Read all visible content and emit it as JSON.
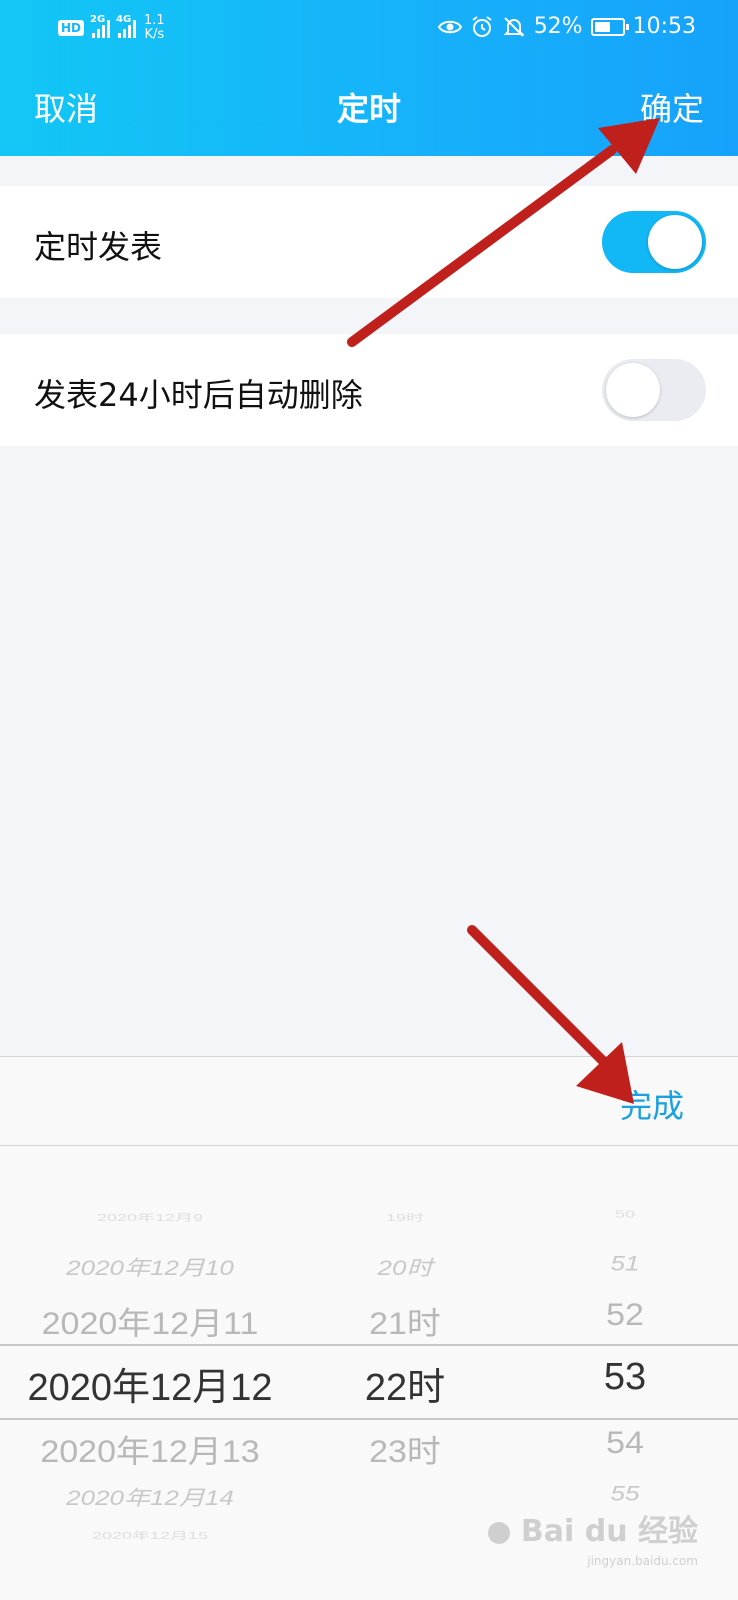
{
  "status_bar": {
    "hd": "HD",
    "sim1": "2G",
    "sim2": "4G",
    "speed": "1.1",
    "speed_unit": "K/s",
    "battery": "52%",
    "time": "10:53"
  },
  "nav": {
    "cancel": "取消",
    "title": "定时",
    "confirm": "确定"
  },
  "settings": {
    "schedule_label": "定时发表",
    "schedule_on": true,
    "auto_delete_label": "发表24小时后自动删除",
    "auto_delete_on": false
  },
  "picker": {
    "done": "完成",
    "dates": [
      "2020年12月9",
      "2020年12月10",
      "2020年12月11",
      "2020年12月12",
      "2020年12月13",
      "2020年12月14",
      "2020年12月15"
    ],
    "hours": [
      "19时",
      "20时",
      "21时",
      "22时",
      "23时",
      "",
      ""
    ],
    "minutes": [
      "50",
      "51",
      "52",
      "53",
      "54",
      "55",
      ""
    ],
    "selected": {
      "date": "2020年12月12",
      "hour": "22时",
      "minute": "53"
    }
  },
  "watermark": {
    "brand": "Bai du 经验",
    "site": "jingyan.baidu.com"
  },
  "colors": {
    "accent": "#12b7f5",
    "done_text": "#1ba0e0",
    "arrow": "#c0201c"
  }
}
